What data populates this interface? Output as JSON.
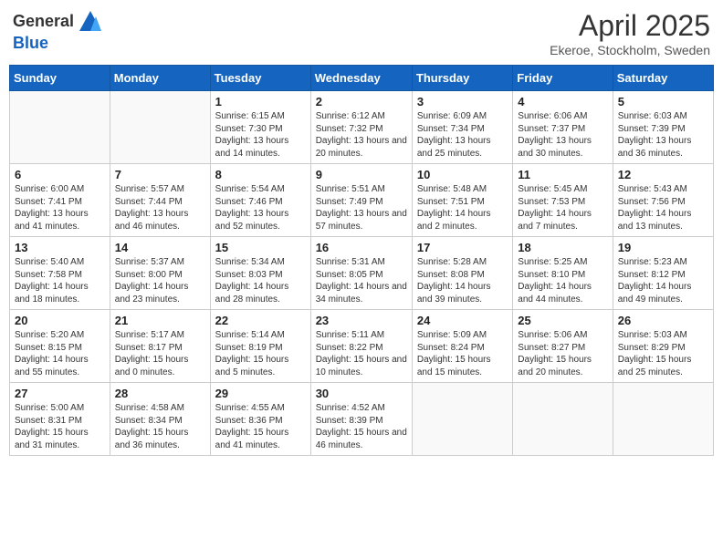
{
  "header": {
    "logo_general": "General",
    "logo_blue": "Blue",
    "title": "April 2025",
    "location": "Ekeroe, Stockholm, Sweden"
  },
  "weekdays": [
    "Sunday",
    "Monday",
    "Tuesday",
    "Wednesday",
    "Thursday",
    "Friday",
    "Saturday"
  ],
  "weeks": [
    [
      {
        "day": "",
        "info": ""
      },
      {
        "day": "",
        "info": ""
      },
      {
        "day": "1",
        "info": "Sunrise: 6:15 AM\nSunset: 7:30 PM\nDaylight: 13 hours and 14 minutes."
      },
      {
        "day": "2",
        "info": "Sunrise: 6:12 AM\nSunset: 7:32 PM\nDaylight: 13 hours and 20 minutes."
      },
      {
        "day": "3",
        "info": "Sunrise: 6:09 AM\nSunset: 7:34 PM\nDaylight: 13 hours and 25 minutes."
      },
      {
        "day": "4",
        "info": "Sunrise: 6:06 AM\nSunset: 7:37 PM\nDaylight: 13 hours and 30 minutes."
      },
      {
        "day": "5",
        "info": "Sunrise: 6:03 AM\nSunset: 7:39 PM\nDaylight: 13 hours and 36 minutes."
      }
    ],
    [
      {
        "day": "6",
        "info": "Sunrise: 6:00 AM\nSunset: 7:41 PM\nDaylight: 13 hours and 41 minutes."
      },
      {
        "day": "7",
        "info": "Sunrise: 5:57 AM\nSunset: 7:44 PM\nDaylight: 13 hours and 46 minutes."
      },
      {
        "day": "8",
        "info": "Sunrise: 5:54 AM\nSunset: 7:46 PM\nDaylight: 13 hours and 52 minutes."
      },
      {
        "day": "9",
        "info": "Sunrise: 5:51 AM\nSunset: 7:49 PM\nDaylight: 13 hours and 57 minutes."
      },
      {
        "day": "10",
        "info": "Sunrise: 5:48 AM\nSunset: 7:51 PM\nDaylight: 14 hours and 2 minutes."
      },
      {
        "day": "11",
        "info": "Sunrise: 5:45 AM\nSunset: 7:53 PM\nDaylight: 14 hours and 7 minutes."
      },
      {
        "day": "12",
        "info": "Sunrise: 5:43 AM\nSunset: 7:56 PM\nDaylight: 14 hours and 13 minutes."
      }
    ],
    [
      {
        "day": "13",
        "info": "Sunrise: 5:40 AM\nSunset: 7:58 PM\nDaylight: 14 hours and 18 minutes."
      },
      {
        "day": "14",
        "info": "Sunrise: 5:37 AM\nSunset: 8:00 PM\nDaylight: 14 hours and 23 minutes."
      },
      {
        "day": "15",
        "info": "Sunrise: 5:34 AM\nSunset: 8:03 PM\nDaylight: 14 hours and 28 minutes."
      },
      {
        "day": "16",
        "info": "Sunrise: 5:31 AM\nSunset: 8:05 PM\nDaylight: 14 hours and 34 minutes."
      },
      {
        "day": "17",
        "info": "Sunrise: 5:28 AM\nSunset: 8:08 PM\nDaylight: 14 hours and 39 minutes."
      },
      {
        "day": "18",
        "info": "Sunrise: 5:25 AM\nSunset: 8:10 PM\nDaylight: 14 hours and 44 minutes."
      },
      {
        "day": "19",
        "info": "Sunrise: 5:23 AM\nSunset: 8:12 PM\nDaylight: 14 hours and 49 minutes."
      }
    ],
    [
      {
        "day": "20",
        "info": "Sunrise: 5:20 AM\nSunset: 8:15 PM\nDaylight: 14 hours and 55 minutes."
      },
      {
        "day": "21",
        "info": "Sunrise: 5:17 AM\nSunset: 8:17 PM\nDaylight: 15 hours and 0 minutes."
      },
      {
        "day": "22",
        "info": "Sunrise: 5:14 AM\nSunset: 8:19 PM\nDaylight: 15 hours and 5 minutes."
      },
      {
        "day": "23",
        "info": "Sunrise: 5:11 AM\nSunset: 8:22 PM\nDaylight: 15 hours and 10 minutes."
      },
      {
        "day": "24",
        "info": "Sunrise: 5:09 AM\nSunset: 8:24 PM\nDaylight: 15 hours and 15 minutes."
      },
      {
        "day": "25",
        "info": "Sunrise: 5:06 AM\nSunset: 8:27 PM\nDaylight: 15 hours and 20 minutes."
      },
      {
        "day": "26",
        "info": "Sunrise: 5:03 AM\nSunset: 8:29 PM\nDaylight: 15 hours and 25 minutes."
      }
    ],
    [
      {
        "day": "27",
        "info": "Sunrise: 5:00 AM\nSunset: 8:31 PM\nDaylight: 15 hours and 31 minutes."
      },
      {
        "day": "28",
        "info": "Sunrise: 4:58 AM\nSunset: 8:34 PM\nDaylight: 15 hours and 36 minutes."
      },
      {
        "day": "29",
        "info": "Sunrise: 4:55 AM\nSunset: 8:36 PM\nDaylight: 15 hours and 41 minutes."
      },
      {
        "day": "30",
        "info": "Sunrise: 4:52 AM\nSunset: 8:39 PM\nDaylight: 15 hours and 46 minutes."
      },
      {
        "day": "",
        "info": ""
      },
      {
        "day": "",
        "info": ""
      },
      {
        "day": "",
        "info": ""
      }
    ]
  ]
}
